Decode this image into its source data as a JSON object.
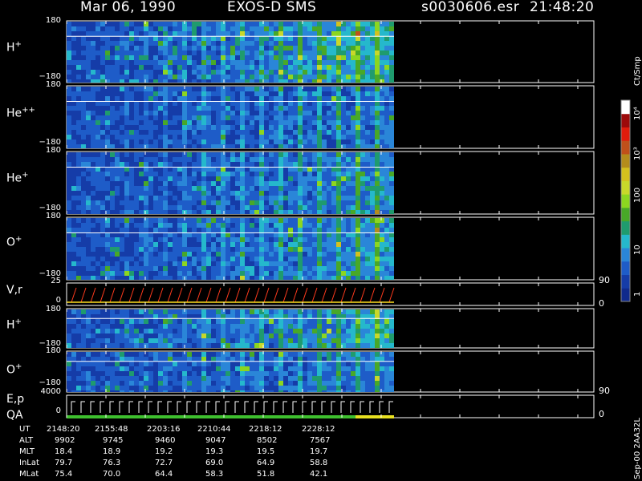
{
  "header": {
    "date": "Mar 06, 1990",
    "mission": "EXOS-D SMS",
    "file": "s0030606.esr",
    "time": "21:48:20"
  },
  "colors": {
    "background": "#000000",
    "foreground": "#ffffff",
    "scale": [
      "#102a8c",
      "#153ca8",
      "#1e5cc8",
      "#2a86d8",
      "#25b8cc",
      "#1f9b6e",
      "#48a828",
      "#8cd620",
      "#c8d82a",
      "#d4c01e",
      "#b48c1c",
      "#c0501a",
      "#e01c0c",
      "#9c0a0a",
      "#ffffff"
    ]
  },
  "chart_data": {
    "type": "heatmap",
    "title": "Mar 06, 1990   EXOS-D SMS",
    "colorbar": {
      "label": "Ct/Smp",
      "scale": "log",
      "range": [
        0.5,
        20000
      ],
      "tick_labels": [
        "1",
        "10",
        "100",
        "10³",
        "10⁴"
      ]
    },
    "panels": [
      {
        "label": "H",
        "charge": "+",
        "ylabel": "",
        "yticks": [
          "180",
          "−180"
        ],
        "yrange": [
          -180,
          180
        ],
        "activity": 0.45
      },
      {
        "label": "He",
        "charge": "++",
        "ylabel": "",
        "yticks": [
          "180",
          "−180"
        ],
        "yrange": [
          -180,
          180
        ],
        "activity": 0.15
      },
      {
        "label": "He",
        "charge": "+",
        "ylabel": "",
        "yticks": [
          "180",
          "−180"
        ],
        "yrange": [
          -180,
          180
        ],
        "activity": 0.25
      },
      {
        "label": "O",
        "charge": "+",
        "ylabel": "",
        "yticks": [
          "180",
          "−180"
        ],
        "yrange": [
          -180,
          180
        ],
        "activity": 0.3
      },
      {
        "label": "V,r",
        "charge": "",
        "yticks": [
          "25",
          "0"
        ],
        "right_ticks": [
          "90",
          "0"
        ],
        "type": "line"
      },
      {
        "label": "H",
        "charge": "+",
        "yticks": [
          "180",
          "−180"
        ],
        "yrange": [
          -180,
          180
        ],
        "activity": 0.4
      },
      {
        "label": "O",
        "charge": "+",
        "yticks": [
          "180",
          "−180"
        ],
        "yrange": [
          -180,
          180
        ],
        "activity": 0.2,
        "right_ticks": [
          "90"
        ]
      },
      {
        "label": "E,p",
        "label2": "QA",
        "charge": "",
        "yticks": [
          "4000",
          "0"
        ],
        "right_ticks": [
          "0"
        ],
        "type": "line"
      }
    ],
    "ephemeris": {
      "rows": [
        "UT",
        "ALT",
        "MLT",
        "InLat",
        "MLat"
      ],
      "columns": [
        [
          "2148:20",
          "9902",
          "18.4",
          "79.7",
          "75.4"
        ],
        [
          "2155:48",
          "9745",
          "18.9",
          "76.3",
          "70.0"
        ],
        [
          "2203:16",
          "9460",
          "19.2",
          "72.7",
          "64.4"
        ],
        [
          "2210:44",
          "9047",
          "19.3",
          "69.0",
          "58.3"
        ],
        [
          "2218:12",
          "8502",
          "19.5",
          "64.9",
          "51.8"
        ],
        [
          "2228:12",
          "7567",
          "19.7",
          "58.8",
          "42.1"
        ]
      ]
    }
  },
  "footer": {
    "version": "Sep-00  2AA32L"
  }
}
